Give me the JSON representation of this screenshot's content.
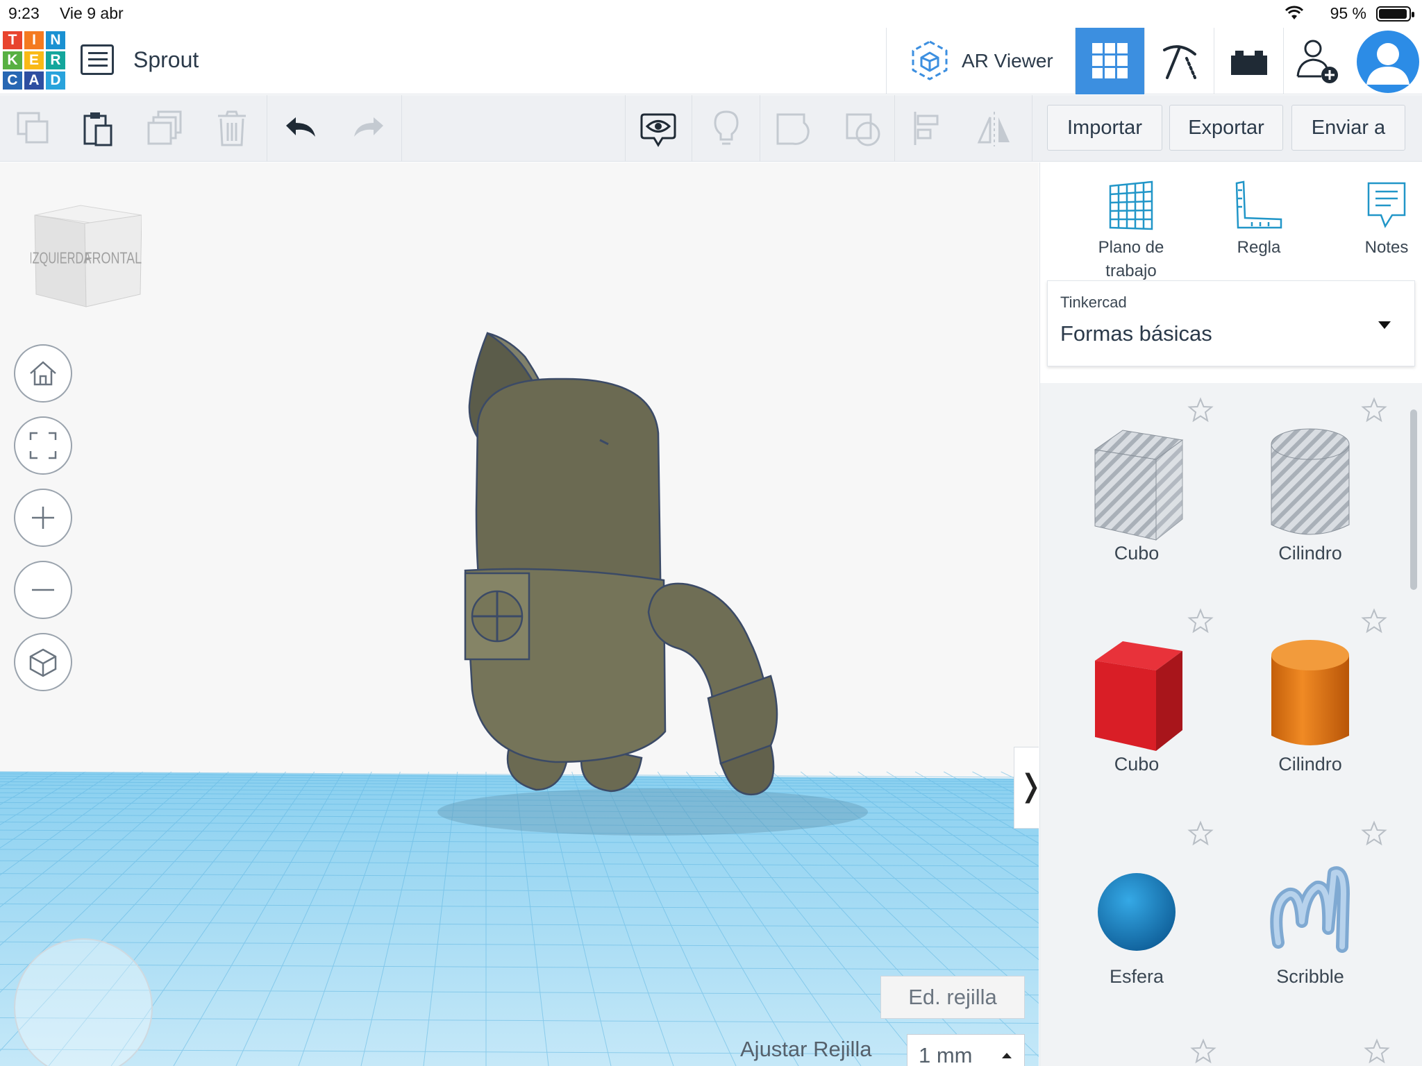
{
  "status_bar": {
    "time": "9:23",
    "date": "Vie 9 abr",
    "battery": "95 %"
  },
  "header": {
    "logo_letters": [
      "T",
      "I",
      "N",
      "K",
      "E",
      "R",
      "C",
      "A",
      "D"
    ],
    "design_title": "Sprout",
    "ar_viewer_label": "AR Viewer",
    "views": [
      "3d-design",
      "codeblocks",
      "bricks"
    ],
    "active_view": "3d-design"
  },
  "toolbar": {
    "import_label": "Importar",
    "export_label": "Exportar",
    "send_label": "Enviar a"
  },
  "viewcube": {
    "left_face": "IZQUIERDA",
    "front_face": "FRONTAL"
  },
  "workplane": {
    "grid_edit_label": "Ed. rejilla",
    "snap_label": "Ajustar Rejilla",
    "snap_value": "1 mm",
    "model_color": "#6b6a52",
    "grid_color": "#7cc8ec"
  },
  "side_panel": {
    "tools": [
      {
        "label": "Plano de trabajo",
        "icon": "workplane-icon"
      },
      {
        "label": "Regla",
        "icon": "ruler-icon"
      },
      {
        "label": "Notes",
        "icon": "notes-icon"
      }
    ],
    "library": {
      "category": "Tinkercad",
      "selected": "Formas básicas"
    },
    "shapes": [
      {
        "name": "Cubo",
        "kind": "hole-box"
      },
      {
        "name": "Cilindro",
        "kind": "hole-cylinder"
      },
      {
        "name": "Cubo",
        "kind": "box",
        "color": "#d91e26"
      },
      {
        "name": "Cilindro",
        "kind": "cylinder",
        "color": "#e57b16"
      },
      {
        "name": "Esfera",
        "kind": "sphere",
        "color": "#1e8ccd"
      },
      {
        "name": "Scribble",
        "kind": "scribble",
        "color": "#8fb8de"
      }
    ]
  }
}
